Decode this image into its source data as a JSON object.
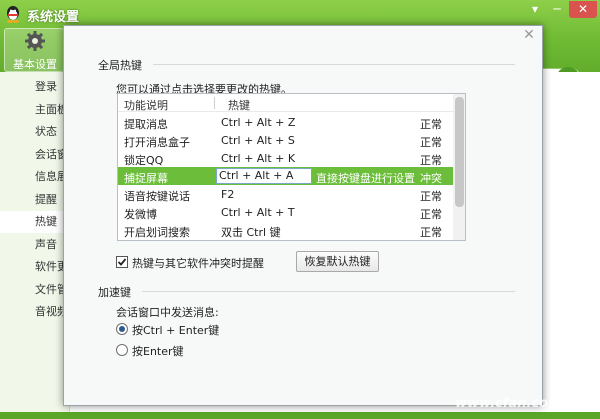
{
  "app": {
    "title": "系统设置",
    "toolbar": {
      "basic_label": "基本设置"
    },
    "sidebar": [
      "登录",
      "主面板",
      "状态",
      "会话窗口",
      "信息展示",
      "提醒",
      "热键",
      "声音",
      "软件更新",
      "文件管理",
      "音视频"
    ],
    "sidebar_active": "热键"
  },
  "dialog": {
    "global_section": "全局热键",
    "hint": "您可以通过点击选择要更改的热键。",
    "table": {
      "headers": [
        "功能说明",
        "热键"
      ],
      "rows": [
        {
          "name": "提取消息",
          "key": "Ctrl + Alt + Z",
          "status": "正常"
        },
        {
          "name": "打开消息盒子",
          "key": "Ctrl + Alt + S",
          "status": "正常"
        },
        {
          "name": "锁定QQ",
          "key": "Ctrl + Alt + K",
          "status": "正常"
        },
        {
          "name": "捕捉屏幕",
          "key": "Ctrl + Alt + A",
          "hint": "直接按键盘进行设置",
          "status": "冲突",
          "selected": true
        },
        {
          "name": "语音按键说话",
          "key": "F2",
          "status": "正常"
        },
        {
          "name": "发微博",
          "key": "Ctrl + Alt + T",
          "status": "正常"
        },
        {
          "name": "开启划词搜索",
          "key": "双击 Ctrl 键",
          "status": "正常"
        }
      ]
    },
    "conflict_check": {
      "label": "热键与其它软件冲突时提醒",
      "checked": true
    },
    "restore_button": "恢复默认热键",
    "accel_section": "加速键",
    "send_label": "会话窗口中发送消息:",
    "send_options": [
      {
        "label": "按Ctrl + Enter键",
        "selected": true
      },
      {
        "label": "按Enter键",
        "selected": false
      }
    ]
  },
  "watermark": "www.cfan.com.cn",
  "colors": {
    "selected_row": "#6cbe3a",
    "titlebar": "#7cc23d"
  }
}
